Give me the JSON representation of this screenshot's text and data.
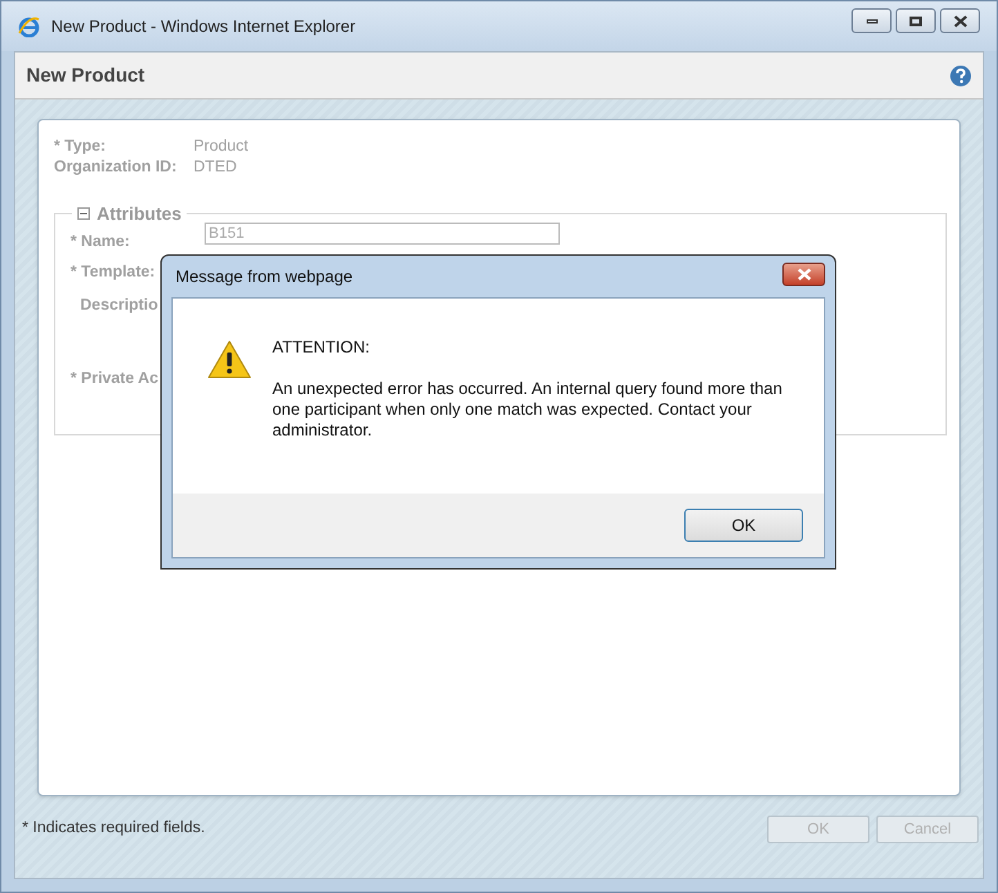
{
  "window": {
    "title": "New Product - Windows Internet Explorer"
  },
  "page": {
    "title": "New Product"
  },
  "summary": [
    {
      "label": "* Type:",
      "value": "Product"
    },
    {
      "label": "Organization ID:",
      "value": "DTED"
    }
  ],
  "attributes": {
    "title": "Attributes",
    "expanded": true,
    "rows": [
      {
        "kind": "field",
        "label": "* Name:",
        "value": "B151"
      },
      {
        "kind": "label",
        "label": "* Template:"
      },
      {
        "kind": "label",
        "label": "Descriptio"
      },
      {
        "kind": "label",
        "label": "* Private Ac"
      }
    ]
  },
  "footer": {
    "note": "* Indicates required fields.",
    "buttons": [
      {
        "label": "OK",
        "disabled": true
      },
      {
        "label": "Cancel",
        "disabled": true
      }
    ]
  },
  "dialog": {
    "title": "Message from webpage",
    "heading": "ATTENTION:",
    "message": "An unexpected error has occurred. An internal query found more than one participant when only one match was expected. Contact your administrator.",
    "button": "OK"
  }
}
